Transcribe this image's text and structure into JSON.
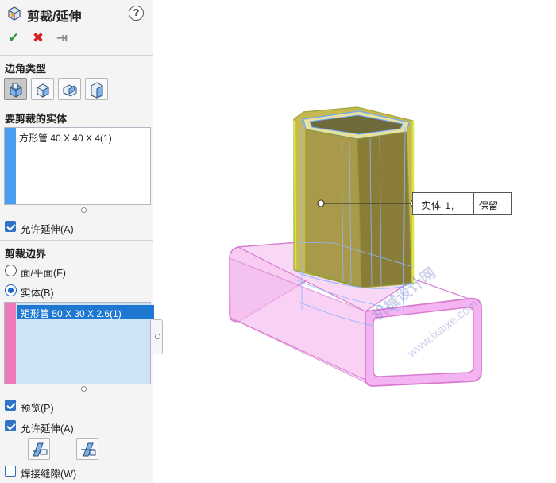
{
  "panel": {
    "title": "剪裁/延伸",
    "help_glyph": "?",
    "commands": {
      "ok_glyph": "✔",
      "cancel_glyph": "✖",
      "pin_glyph": "⇥"
    }
  },
  "corner_type": {
    "heading": "边角类型",
    "buttons": [
      "corner-end-trim",
      "corner-type-2",
      "corner-type-3",
      "corner-type-4"
    ],
    "selected_index": 0
  },
  "bodies_to_trim": {
    "heading": "要剪裁的实体",
    "items": [
      "方形管 40 X 40 X 4(1)"
    ],
    "stripe_color": "#4a9ef0",
    "allow_extend_label": "允许延伸(A)",
    "allow_extend_checked": true
  },
  "trim_boundary": {
    "heading": "剪裁边界",
    "option_face": "面/平面(F)",
    "option_body": "实体(B)",
    "selected_option": "body",
    "items": [
      "矩形管 50 X 30 X 2.6(1)"
    ],
    "stripe_color": "#f07ab8",
    "preview_label": "预览(P)",
    "preview_checked": true,
    "allow_extend_label": "允许延伸(A)",
    "allow_extend_checked": true,
    "weld_gap_label": "焊接缝隙(W)",
    "weld_gap_checked": false
  },
  "viewport": {
    "callout": {
      "left_text": "实体  1,",
      "right_text": "保留"
    },
    "watermark_main": "机械设计网",
    "watermark_sub": "www.ixaixe.com",
    "colors": {
      "vertical_tube": "#c8b850",
      "horizontal_tube": "#f3a8f0",
      "edge_highlight": "#6aa8ff"
    }
  }
}
